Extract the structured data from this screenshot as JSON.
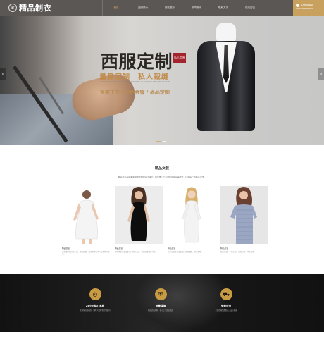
{
  "header": {
    "logo_text": "精品制衣",
    "logo_mark": "♛",
    "nav": [
      "首页",
      "品牌简介",
      "服装展示",
      "新闻资讯",
      "联系方式",
      "在线留言"
    ],
    "hotline_label": "全国服务热线",
    "hotline_number": "0898-66888888"
  },
  "banner": {
    "title": "西服定制",
    "seal": "私人定制",
    "subtitle": "量身定制　私人裁缝",
    "english": "FINE TAILORED BRAND CUSTOMIZED TAILORING PRIVATE TAILOR",
    "tagline": "坚实工艺 / 中西合璧 / 尚品定制",
    "prev_arrow": "‹",
    "next_arrow": "›"
  },
  "section": {
    "title": "精品女装",
    "description": "精品女装品牌秉承精致优雅的设计理念，将传统工艺与现代时尚完美融合，打造每一件精心之作。"
  },
  "products": [
    {
      "caption": "精品女装",
      "desc": "白色镂空蕾丝连衣裙，优雅浪漫，适合夏季出行与各类休闲场合。"
    },
    {
      "caption": "精品女装",
      "desc": "经典黑色修身连衣裙，简约大方，彰显女性优雅气质。"
    },
    {
      "caption": "精品女装",
      "desc": "白色长袖修身连衣裙，质感细腻，端庄秀丽。"
    },
    {
      "caption": "精品女装",
      "desc": "蓝白条纹一字领上衣，清新自然，时尚百搭。"
    }
  ],
  "features": [
    {
      "icon": "clock-icon",
      "glyph": "◴",
      "title": "24小时贴心客服",
      "desc": "全天候在线服务，随时为您解答定制疑问"
    },
    {
      "icon": "shield-icon",
      "glyph": "⛨",
      "title": "质量保障",
      "desc": "精选优质面料，匠心工艺保证品质"
    },
    {
      "icon": "truck-icon",
      "glyph": "⛟",
      "title": "免费送货",
      "desc": "全国范围免费配送，安心便捷"
    }
  ]
}
